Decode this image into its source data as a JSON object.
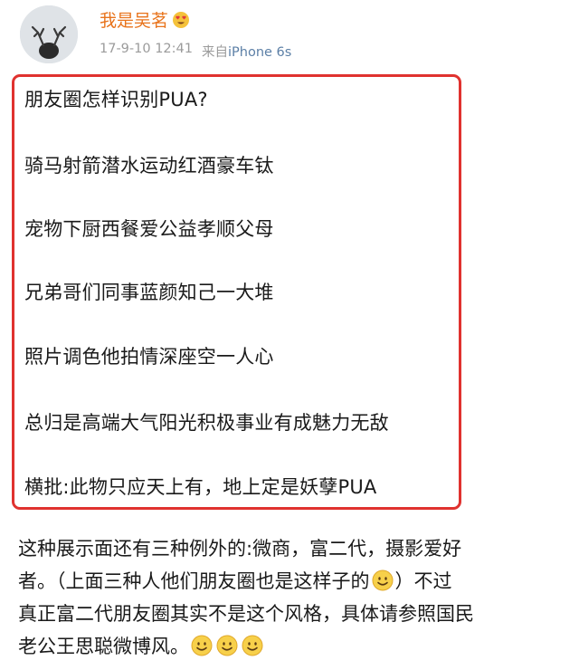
{
  "header": {
    "username": "我是吴茗",
    "timestamp": "17-9-10 12:41",
    "source_prefix": "来自",
    "source": "iPhone 6s",
    "username_color": "#e8731b"
  },
  "post": {
    "lines": [
      "朋友圈怎样识别PUA?",
      "骑马射箭潜水运动红酒豪车钛",
      "宠物下厨西餐爱公益孝顺父母",
      "兄弟哥们同事蓝颜知己一大堆",
      "照片调色他拍情深座空一人心",
      "总归是高端大气阳光积极事业有成魅力无敌",
      "横批:此物只应天上有，地上定是妖孽PUA"
    ],
    "border_color": "#e0322f"
  },
  "comment": {
    "line1": "这种展示面还有三种例外的:微商，富二代，摄影爱好",
    "line2a": "者。（上面三种人他们朋友圈也是这样子的",
    "line2b": "）不过",
    "line3": "真正富二代朋友圈其实不是这个风格，具体请参照国民",
    "line4": "老公王思聪微博风。"
  },
  "icons": {
    "emoji_heart_eyes": "heart-eyes-emoji-icon",
    "emoji_smile": "smile-emoji-icon"
  }
}
